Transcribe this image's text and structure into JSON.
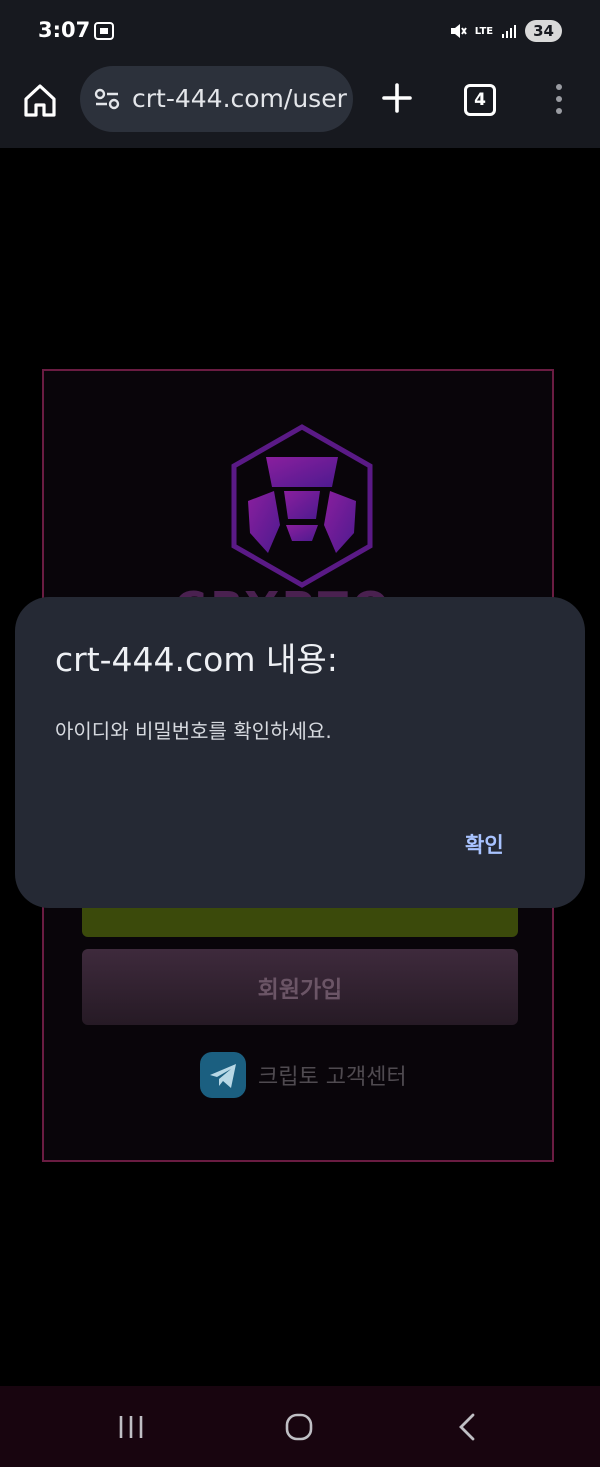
{
  "status_bar": {
    "time": "3:07",
    "network": "LTE",
    "battery": "34"
  },
  "browser": {
    "url": "crt-444.com/user",
    "tab_count": "4"
  },
  "page": {
    "logo_word": "CRYPTO",
    "signup_label": "회원가입",
    "support_label": "크립토 고객센터"
  },
  "dialog": {
    "title": "crt-444.com 내용:",
    "message": "아이디와 비밀번호를 확인하세요.",
    "ok_label": "확인"
  },
  "colors": {
    "accent": "#a9c3ff",
    "dialog_bg": "#252934",
    "brand": "#7a1f9a"
  },
  "icons": [
    "home-icon",
    "site-settings-icon",
    "plus-icon",
    "tabs-icon",
    "more-vert-icon",
    "recent-apps-icon",
    "nav-home-icon",
    "back-icon",
    "telegram-icon",
    "crypto-logo"
  ]
}
